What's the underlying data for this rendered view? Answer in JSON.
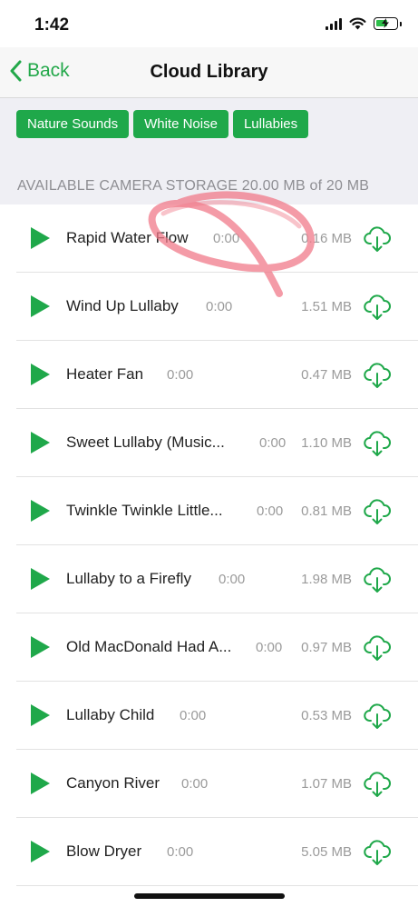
{
  "status_bar": {
    "time": "1:42",
    "icons": [
      "signal-icon",
      "wifi-icon",
      "battery-charging-icon"
    ]
  },
  "nav": {
    "back_label": "Back",
    "title": "Cloud Library"
  },
  "tags": [
    "Nature Sounds",
    "White Noise",
    "Lullabies"
  ],
  "storage_text": "AVAILABLE CAMERA STORAGE 20.00 MB of 20 MB",
  "colors": {
    "accent": "#1fa84a",
    "annotation": "#f07a8a"
  },
  "items": [
    {
      "title": "Rapid Water Flow",
      "duration": "0:00",
      "size": "0.16 MB"
    },
    {
      "title": "Wind Up Lullaby",
      "duration": "0:00",
      "size": "1.51 MB"
    },
    {
      "title": "Heater Fan",
      "duration": "0:00",
      "size": "0.47 MB"
    },
    {
      "title": "Sweet Lullaby (Music...",
      "duration": "0:00",
      "size": "1.10 MB"
    },
    {
      "title": "Twinkle Twinkle Little...",
      "duration": "0:00",
      "size": "0.81 MB"
    },
    {
      "title": "Lullaby to a Firefly",
      "duration": "0:00",
      "size": "1.98 MB"
    },
    {
      "title": "Old MacDonald Had A...",
      "duration": "0:00",
      "size": "0.97 MB"
    },
    {
      "title": "Lullaby Child",
      "duration": "0:00",
      "size": "0.53 MB"
    },
    {
      "title": "Canyon River",
      "duration": "0:00",
      "size": "1.07 MB"
    },
    {
      "title": "Blow Dryer",
      "duration": "0:00",
      "size": "5.05 MB"
    }
  ]
}
